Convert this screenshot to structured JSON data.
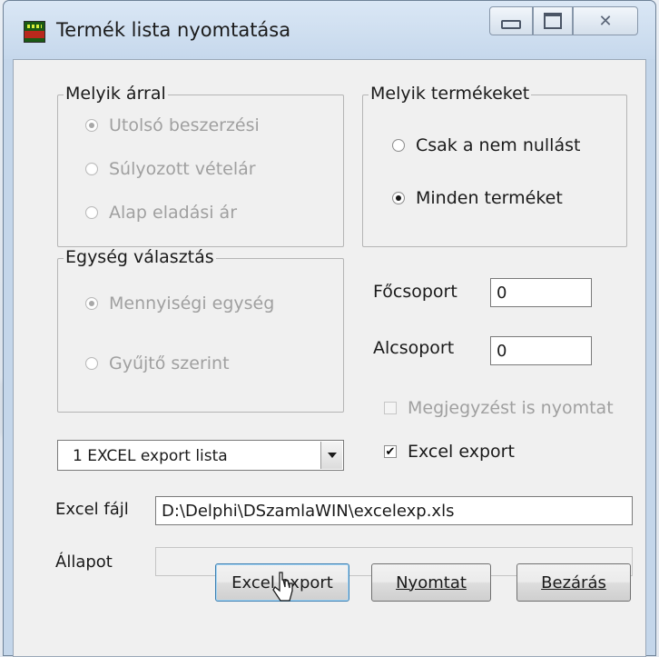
{
  "window": {
    "title": "Termék lista nyomtatása",
    "close_glyph": "✕"
  },
  "price_group": {
    "label": "Melyik árral",
    "options": [
      {
        "label": "Utolsó beszerzési",
        "checked": true,
        "enabled": false
      },
      {
        "label": "Súlyozott vételár",
        "checked": false,
        "enabled": false
      },
      {
        "label": "Alap eladási ár",
        "checked": false,
        "enabled": false
      }
    ]
  },
  "products_group": {
    "label": "Melyik termékeket",
    "options": [
      {
        "label": "Csak a nem nullást",
        "checked": false,
        "enabled": true
      },
      {
        "label": "Minden terméket",
        "checked": true,
        "enabled": true
      }
    ]
  },
  "unit_group": {
    "label": "Egység választás",
    "options": [
      {
        "label": "Mennyiségi egység",
        "checked": true,
        "enabled": false
      },
      {
        "label": "Gyűjtő szerint",
        "checked": false,
        "enabled": false
      }
    ]
  },
  "main_group": {
    "label": "Főcsoport",
    "value": "0"
  },
  "sub_group": {
    "label": "Alcsoport",
    "value": "0"
  },
  "note_checkbox": {
    "label": "Megjegyzést is nyomtat",
    "checked": false,
    "enabled": false
  },
  "excel_checkbox": {
    "label": "Excel export",
    "checked": true,
    "enabled": true,
    "check_glyph": "✔"
  },
  "report_select": {
    "value": "1 EXCEL export lista"
  },
  "excel_file": {
    "label": "Excel fájl",
    "value": "D:\\Delphi\\DSzamlaWIN\\excelexp.xls"
  },
  "status": {
    "label": "Állapot",
    "value": ""
  },
  "buttons": {
    "export_label": "Excel export",
    "print_label": "Nyomtat",
    "close_label": "Bezárás"
  },
  "icons": {
    "app": "app-icon",
    "minimize": "minimize-icon",
    "maximize": "maximize-icon",
    "close": "close-icon",
    "dropdown": "chevron-down-icon",
    "cursor": "mouse-cursor-icon"
  }
}
